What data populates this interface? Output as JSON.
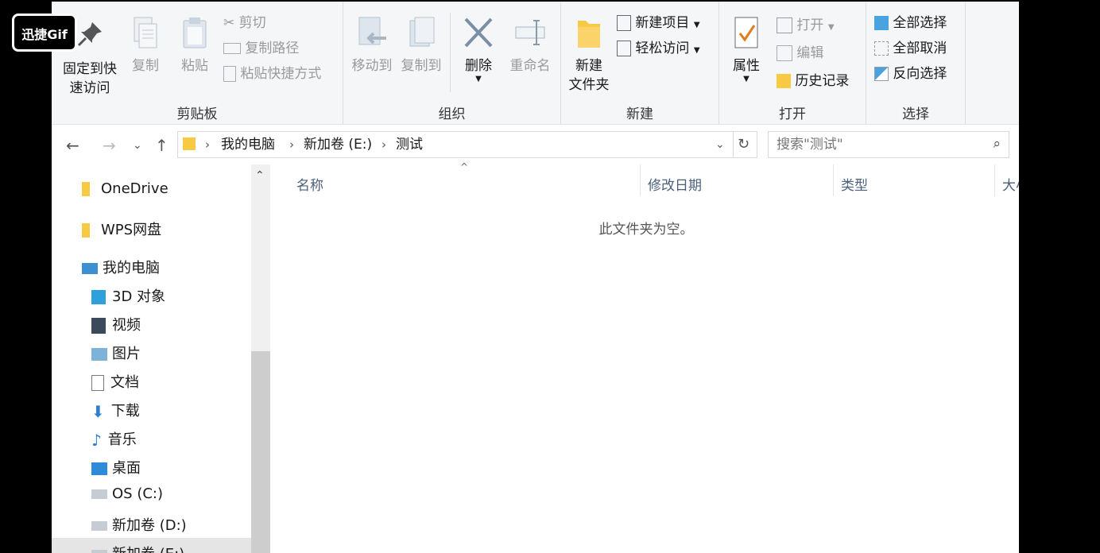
{
  "watermark": "迅捷Gif",
  "ribbon": {
    "clipboard": {
      "pin": "固定到快\n速访问",
      "copy": "复制",
      "paste": "粘贴",
      "cut": "剪切",
      "copy_path": "复制路径",
      "paste_shortcut": "粘贴快捷方式",
      "label": "剪贴板"
    },
    "organize": {
      "move_to": "移动到",
      "copy_to": "复制到",
      "delete": "删除",
      "rename": "重命名",
      "label": "组织"
    },
    "new": {
      "new_folder": "新建\n文件夹",
      "new_item": "新建项目",
      "easy_access": "轻松访问",
      "label": "新建"
    },
    "open": {
      "properties": "属性",
      "open": "打开",
      "edit": "编辑",
      "history": "历史记录",
      "label": "打开"
    },
    "select": {
      "select_all": "全部选择",
      "select_none": "全部取消",
      "invert": "反向选择",
      "label": "选择"
    }
  },
  "address": {
    "crumbs": [
      "我的电脑",
      "新加卷 (E:)",
      "测试"
    ]
  },
  "search": {
    "placeholder": "搜索\"测试\""
  },
  "nav": {
    "items": [
      "OneDrive",
      "WPS网盘",
      "我的电脑",
      "3D 对象",
      "视频",
      "图片",
      "文档",
      "下载",
      "音乐",
      "桌面",
      "OS (C:)",
      "新加卷 (D:)",
      "新加卷 (E:)"
    ]
  },
  "columns": {
    "name": "名称",
    "modified": "修改日期",
    "type": "类型",
    "size": "大小"
  },
  "empty_message": "此文件夹为空。"
}
